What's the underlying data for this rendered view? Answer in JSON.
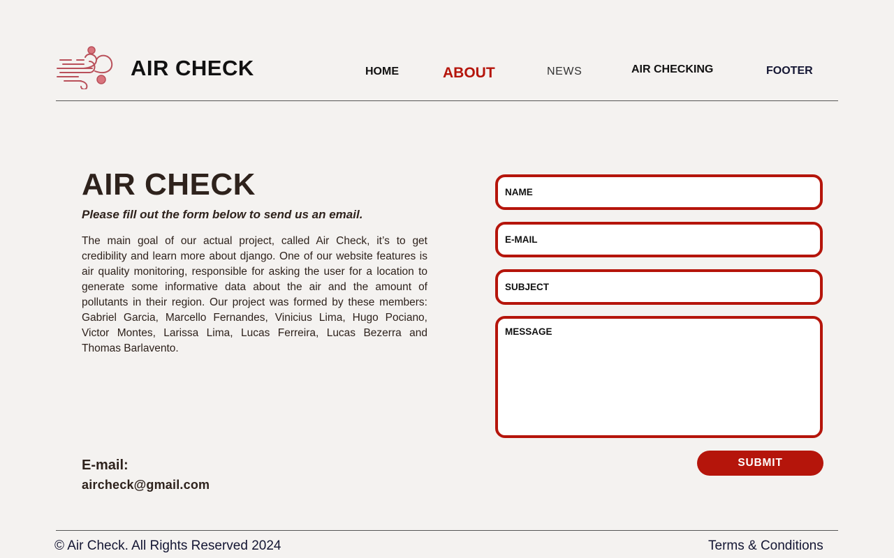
{
  "header": {
    "brand": "AIR CHECK",
    "logo_icon": "wind-icon",
    "nav": {
      "home": "HOME",
      "about": "ABOUT",
      "news": "NEWS",
      "air_checking": "AIR CHECKING",
      "footer": "FOOTER"
    },
    "active_nav": "about"
  },
  "intro": {
    "title": "AIR CHECK",
    "subtitle": "Please fill out the form below to send us an email.",
    "description": "The main goal of our actual project, called Air Check, it’s to get credibility and learn more about django. One of our website features is air quality monitoring, responsible for asking the user for a location to generate some informative data about the air and the amount of pollutants in their region. Our project was formed by these members: Gabriel Garcia, Marcello Fernandes, Vinicius Lima, Hugo Pociano, Victor Montes, Larissa Lima, Lucas Ferreira, Lucas Bezerra and Thomas Barlavento."
  },
  "contact": {
    "email_label": "E-mail:",
    "email_value": "aircheck@gmail.com"
  },
  "form": {
    "name_placeholder": "NAME",
    "email_placeholder": "E-MAIL",
    "subject_placeholder": "SUBJECT",
    "message_placeholder": "MESSAGE",
    "submit_label": "SUBMIT"
  },
  "footer": {
    "copyright": "© Air Check. All Rights Reserved 2024",
    "terms": "Terms & Conditions"
  },
  "colors": {
    "accent": "#b5150b",
    "background": "#f4f2f0",
    "text_dark": "#2e221c",
    "footer_text": "#141633",
    "logo": "#b9505a"
  }
}
